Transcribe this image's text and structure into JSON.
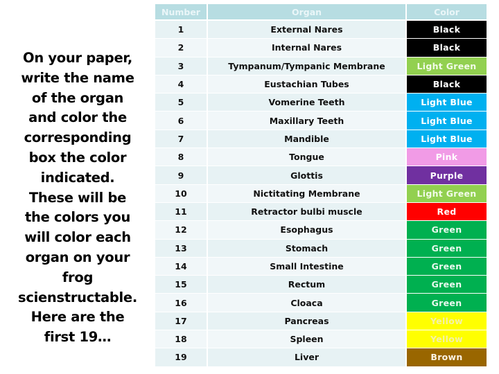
{
  "instructions": "On your paper, write the name of the organ and color the corresponding box the color indicated. These will be the colors you will color each organ on your frog scienstructable. Here are the first 19…",
  "table": {
    "headers": {
      "number": "Number",
      "organ": "Organ",
      "color": "Color"
    },
    "rows": [
      {
        "number": "1",
        "organ": "External Nares",
        "color": "Black",
        "swatch": "#000000",
        "text_color": "#ffffff"
      },
      {
        "number": "2",
        "organ": "Internal Nares",
        "color": "Black",
        "swatch": "#000000",
        "text_color": "#ffffff"
      },
      {
        "number": "3",
        "organ": "Tympanum/Tympanic Membrane",
        "color": "Light Green",
        "swatch": "#92d050",
        "text_color": "#f2fbe8"
      },
      {
        "number": "4",
        "organ": "Eustachian Tubes",
        "color": "Black",
        "swatch": "#000000",
        "text_color": "#ffffff"
      },
      {
        "number": "5",
        "organ": "Vomerine Teeth",
        "color": "Light Blue",
        "swatch": "#00b0f0",
        "text_color": "#ffffff"
      },
      {
        "number": "6",
        "organ": "Maxillary Teeth",
        "color": "Light Blue",
        "swatch": "#00b0f0",
        "text_color": "#ffffff"
      },
      {
        "number": "7",
        "organ": "Mandible",
        "color": "Light Blue",
        "swatch": "#00b0f0",
        "text_color": "#ffffff"
      },
      {
        "number": "8",
        "organ": "Tongue",
        "color": "Pink",
        "swatch": "#f19be6",
        "text_color": "#ffffff"
      },
      {
        "number": "9",
        "organ": "Glottis",
        "color": "Purple",
        "swatch": "#7030a0",
        "text_color": "#ffffff"
      },
      {
        "number": "10",
        "organ": "Nictitating Membrane",
        "color": "Light Green",
        "swatch": "#92d050",
        "text_color": "#f2fbe8"
      },
      {
        "number": "11",
        "organ": "Retractor bulbi muscle",
        "color": "Red",
        "swatch": "#ff0000",
        "text_color": "#ffffff"
      },
      {
        "number": "12",
        "organ": "Esophagus",
        "color": "Green",
        "swatch": "#00b050",
        "text_color": "#e8f8ee"
      },
      {
        "number": "13",
        "organ": "Stomach",
        "color": "Green",
        "swatch": "#00b050",
        "text_color": "#e8f8ee"
      },
      {
        "number": "14",
        "organ": "Small Intestine",
        "color": "Green",
        "swatch": "#00b050",
        "text_color": "#e8f8ee"
      },
      {
        "number": "15",
        "organ": "Rectum",
        "color": "Green",
        "swatch": "#00b050",
        "text_color": "#e8f8ee"
      },
      {
        "number": "16",
        "organ": "Cloaca",
        "color": "Green",
        "swatch": "#00b050",
        "text_color": "#e8f8ee"
      },
      {
        "number": "17",
        "organ": "Pancreas",
        "color": "Yellow",
        "swatch": "#ffff00",
        "text_color": "#f4f0a8"
      },
      {
        "number": "18",
        "organ": "Spleen",
        "color": "Yellow",
        "swatch": "#ffff00",
        "text_color": "#f4f0a8"
      },
      {
        "number": "19",
        "organ": "Liver",
        "color": "Brown",
        "swatch": "#996600",
        "text_color": "#fbf3e4"
      }
    ]
  }
}
